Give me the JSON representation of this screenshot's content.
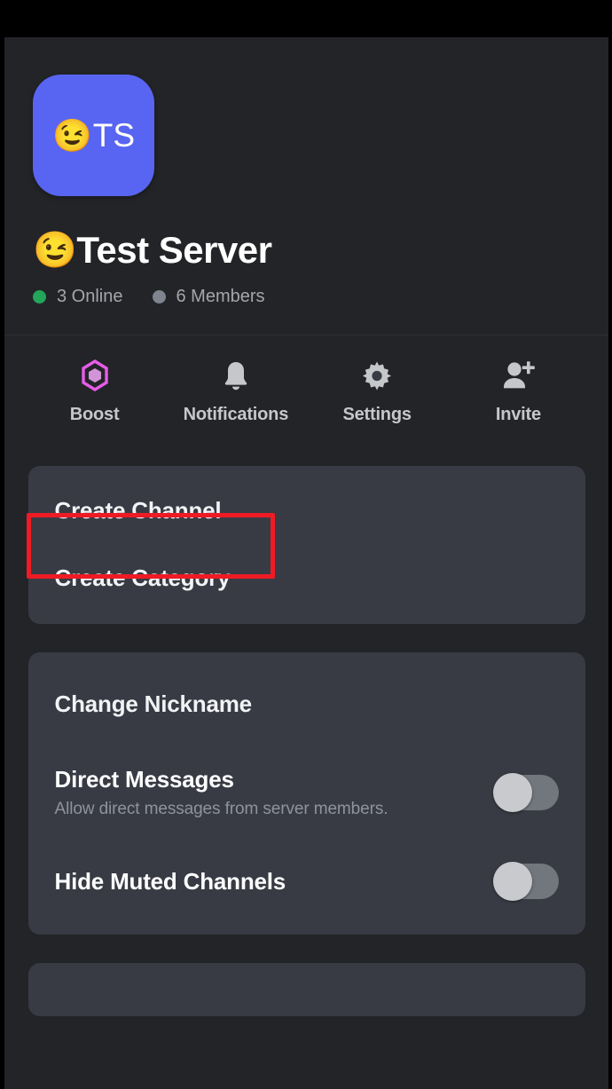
{
  "app": {
    "platform": "discord-mobile",
    "background_color": "#232428",
    "card_color": "#383b44",
    "accent_color": "#5865f2"
  },
  "server": {
    "icon": {
      "emoji": "😉",
      "initials": "TS",
      "background_color": "#5865f2"
    },
    "name_emoji": "😉",
    "name": "Test Server",
    "stats": [
      {
        "label": "3 Online",
        "dot_color": "#23a55a",
        "dot_name": "online-status-dot"
      },
      {
        "label": "6 Members",
        "dot_color": "#80848e",
        "dot_name": "members-status-dot"
      }
    ]
  },
  "actions": [
    {
      "label": "Boost",
      "icon": "boost-gem-icon",
      "color": "#e75ce8"
    },
    {
      "label": "Notifications",
      "icon": "bell-icon",
      "color": "#c5c7cb"
    },
    {
      "label": "Settings",
      "icon": "gear-icon",
      "color": "#c5c7cb"
    },
    {
      "label": "Invite",
      "icon": "person-add-icon",
      "color": "#c5c7cb"
    }
  ],
  "cards": {
    "creation": {
      "create_channel": "Create Channel",
      "create_category": "Create Category"
    },
    "preferences": {
      "change_nickname": "Change Nickname",
      "direct_messages": {
        "title": "Direct Messages",
        "subtitle": "Allow direct messages from server members.",
        "toggle_state": "off"
      },
      "hide_muted_channels": {
        "title": "Hide Muted Channels",
        "toggle_state": "off"
      }
    }
  },
  "annotation": {
    "target": "Create Channel",
    "color": "#ee1b24"
  }
}
